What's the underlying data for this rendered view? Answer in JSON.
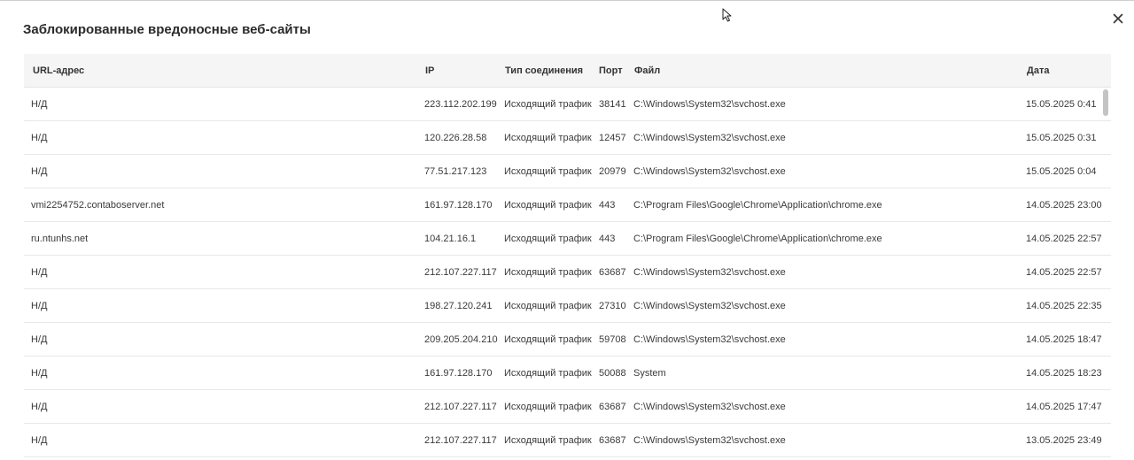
{
  "dialog": {
    "title": "Заблокированные вредоносные веб-сайты"
  },
  "icons": {
    "close": "close-icon",
    "cursor": "mouse-pointer-icon"
  },
  "table": {
    "columns": {
      "url": "URL-адрес",
      "ip": "IP",
      "type": "Тип соединения",
      "port": "Порт",
      "file": "Файл",
      "date": "Дата"
    },
    "rows": [
      {
        "url": "Н/Д",
        "ip": "223.112.202.199",
        "type": "Исходящий трафик",
        "port": "38141",
        "file": "C:\\Windows\\System32\\svchost.exe",
        "date": "15.05.2025 0:41"
      },
      {
        "url": "Н/Д",
        "ip": "120.226.28.58",
        "type": "Исходящий трафик",
        "port": "12457",
        "file": "C:\\Windows\\System32\\svchost.exe",
        "date": "15.05.2025 0:31"
      },
      {
        "url": "Н/Д",
        "ip": "77.51.217.123",
        "type": "Исходящий трафик",
        "port": "20979",
        "file": "C:\\Windows\\System32\\svchost.exe",
        "date": "15.05.2025 0:04"
      },
      {
        "url": "vmi2254752.contaboserver.net",
        "ip": "161.97.128.170",
        "type": "Исходящий трафик",
        "port": "443",
        "file": "C:\\Program Files\\Google\\Chrome\\Application\\chrome.exe",
        "date": "14.05.2025 23:00"
      },
      {
        "url": "ru.ntunhs.net",
        "ip": "104.21.16.1",
        "type": "Исходящий трафик",
        "port": "443",
        "file": "C:\\Program Files\\Google\\Chrome\\Application\\chrome.exe",
        "date": "14.05.2025 22:57"
      },
      {
        "url": "Н/Д",
        "ip": "212.107.227.117",
        "type": "Исходящий трафик",
        "port": "63687",
        "file": "C:\\Windows\\System32\\svchost.exe",
        "date": "14.05.2025 22:57"
      },
      {
        "url": "Н/Д",
        "ip": "198.27.120.241",
        "type": "Исходящий трафик",
        "port": "27310",
        "file": "C:\\Windows\\System32\\svchost.exe",
        "date": "14.05.2025 22:35"
      },
      {
        "url": "Н/Д",
        "ip": "209.205.204.210",
        "type": "Исходящий трафик",
        "port": "59708",
        "file": "C:\\Windows\\System32\\svchost.exe",
        "date": "14.05.2025 18:47"
      },
      {
        "url": "Н/Д",
        "ip": "161.97.128.170",
        "type": "Исходящий трафик",
        "port": "50088",
        "file": "System",
        "date": "14.05.2025 18:23"
      },
      {
        "url": "Н/Д",
        "ip": "212.107.227.117",
        "type": "Исходящий трафик",
        "port": "63687",
        "file": "C:\\Windows\\System32\\svchost.exe",
        "date": "14.05.2025 17:47"
      },
      {
        "url": "Н/Д",
        "ip": "212.107.227.117",
        "type": "Исходящий трафик",
        "port": "63687",
        "file": "C:\\Windows\\System32\\svchost.exe",
        "date": "13.05.2025 23:49"
      }
    ]
  }
}
